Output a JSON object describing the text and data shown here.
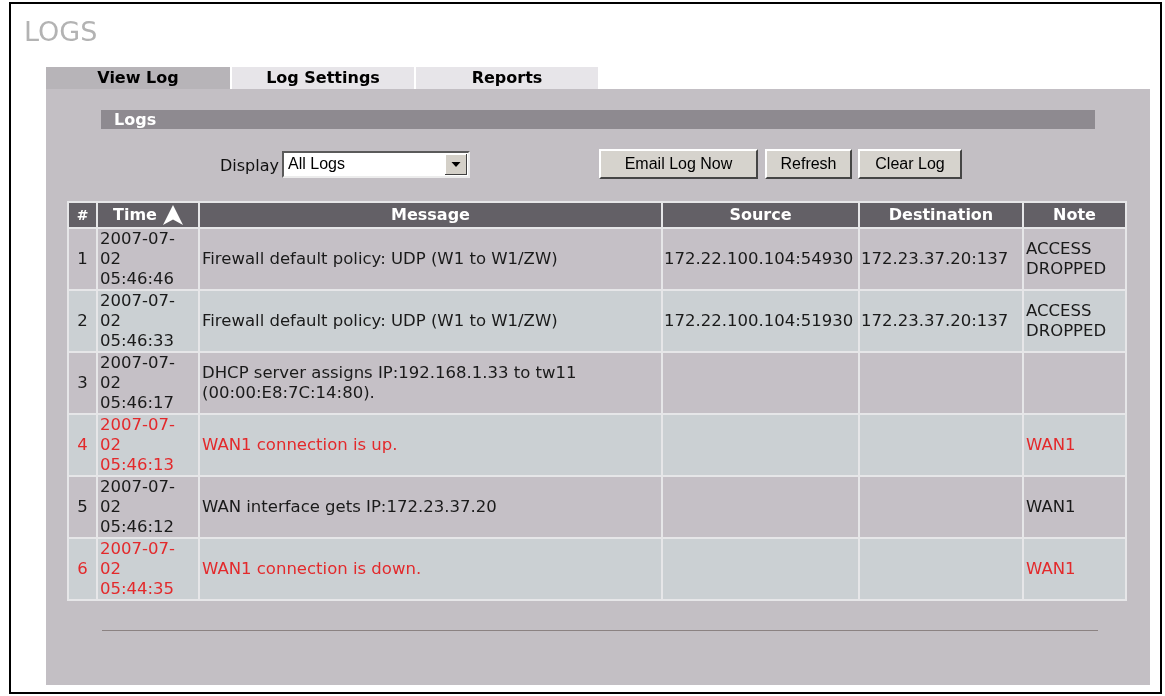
{
  "page": {
    "title": "LOGS"
  },
  "tabs": [
    {
      "label": "View Log",
      "selected": true
    },
    {
      "label": "Log Settings",
      "selected": false
    },
    {
      "label": "Reports",
      "selected": false
    }
  ],
  "section": {
    "title": "Logs"
  },
  "display_filter": {
    "label": "Display",
    "value": "All Logs"
  },
  "buttons": [
    "Email Log Now",
    "Refresh",
    "Clear Log"
  ],
  "table": {
    "columns": [
      {
        "label": "#",
        "sorted": false
      },
      {
        "label": "Time",
        "sorted": true
      },
      {
        "label": "Message",
        "sorted": false
      },
      {
        "label": "Source",
        "sorted": false
      },
      {
        "label": "Destination",
        "sorted": false
      },
      {
        "label": "Note",
        "sorted": false
      }
    ],
    "rows": [
      {
        "number": "1",
        "date": "2007-07-02",
        "time": "05:46:46",
        "message": "Firewall default policy: UDP (W1 to W1/ZW)",
        "source": "172.22.100.104:54930",
        "destination": "172.23.37.20:137",
        "note": "ACCESS DROPPED",
        "alert": false
      },
      {
        "number": "2",
        "date": "2007-07-02",
        "time": "05:46:33",
        "message": "Firewall default policy: UDP (W1 to W1/ZW)",
        "source": "172.22.100.104:51930",
        "destination": "172.23.37.20:137",
        "note": "ACCESS DROPPED",
        "alert": false
      },
      {
        "number": "3",
        "date": "2007-07-02",
        "time": "05:46:17",
        "message": "DHCP server assigns IP:192.168.1.33 to tw11 (00:00:E8:7C:14:80).",
        "alert": false
      },
      {
        "number": "4",
        "date": "2007-07-02",
        "time": "05:46:13",
        "message": "WAN1 connection is up.",
        "note": "WAN1",
        "alert": true
      },
      {
        "number": "5",
        "date": "2007-07-02",
        "time": "05:46:12",
        "message": "WAN interface gets IP:172.23.37.20",
        "note": "WAN1",
        "alert": false
      },
      {
        "number": "6",
        "date": "2007-07-02",
        "time": "05:44:35",
        "message": "WAN1 connection is down.",
        "note": "WAN1",
        "alert": true
      }
    ]
  }
}
